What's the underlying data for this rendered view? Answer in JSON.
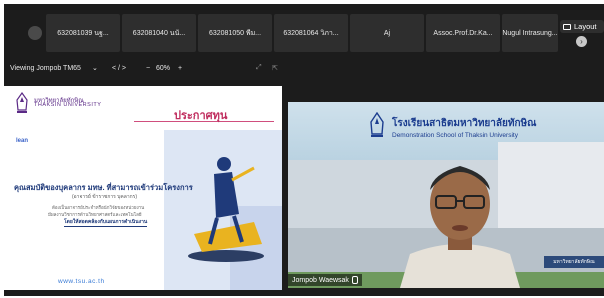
{
  "participants": [
    {
      "name": "632081039 นฐ..."
    },
    {
      "name": "632081040 นนั..."
    },
    {
      "name": "632081050 พีม..."
    },
    {
      "name": "632081064 วิภา..."
    },
    {
      "name": "Aj"
    },
    {
      "name": "Assoc.Prof.Dr.Ka..."
    },
    {
      "name": "Nugul Intrasung..."
    }
  ],
  "toolbar": {
    "layout_label": "Layout",
    "viewing_label": "Viewing Jompob TM65",
    "page_indicator": "< / >",
    "zoom_minus": "−",
    "zoom_value": "60%",
    "zoom_plus": "+"
  },
  "shared_slide": {
    "university_th": "มหาวิทยาลัยทักษิณ",
    "university_en": "THAKSIN UNIVERSITY",
    "small_logo_text": "lean",
    "headline": "ประกาศทุน",
    "subhead": "คุณสมบัติของบุคลากร มทษ. ที่สามารถเข้าร่วมโครงการ",
    "line2": "(อาจารย์ ข้าราชการ บุคลากร)",
    "line3": "ต้องเป็นอาจารย์ประจำหรือนักวิจัยของหน่วยงาน",
    "line4": "มีผลงานวิชาการด้านวิทยาศาสตร์และเทคโนโลยี",
    "line5": "โดยให้สอดคล้องกับแผนการดำเนินงาน",
    "url": "www.tsu.ac.th"
  },
  "video": {
    "school_th": "โรงเรียนสาธิตมหาวิทยาลัยทักษิณ",
    "school_en": "Demonstration School of Thaksin University",
    "speaker_name": "Jompob Waewsak",
    "sign_text": "มหาวิทยาลัยทักษิณ"
  },
  "colors": {
    "app_bg": "#1c1c1c",
    "tile_bg": "#2e2e2e",
    "slide_accent": "#c02e5f",
    "slide_navy": "#1f3a7a"
  }
}
